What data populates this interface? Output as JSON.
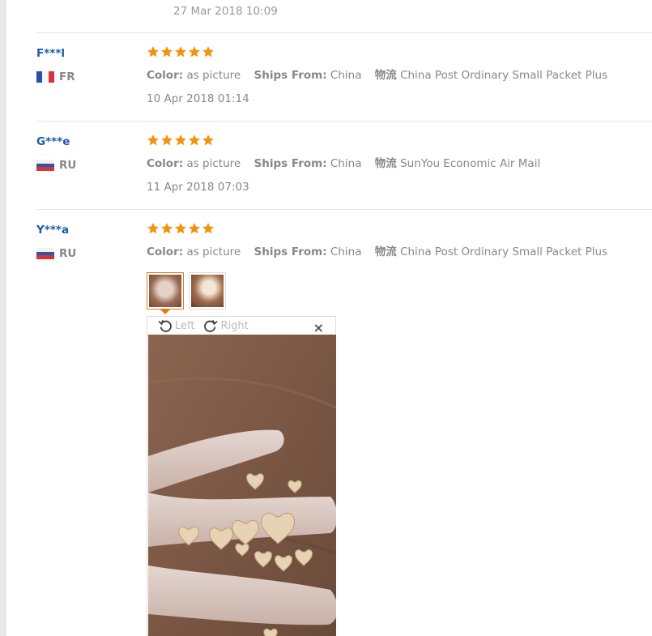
{
  "top_review": {
    "date": "27 Mar 2018 10:09"
  },
  "reviews": [
    {
      "user": "F***l",
      "country": "FR",
      "color_label": "Color:",
      "color_value": "as picture",
      "ships_label": "Ships From:",
      "ships_value": "China",
      "logistics_label": "物流",
      "logistics_value": "China Post Ordinary Small Packet Plus",
      "date": "10 Apr 2018 01:14",
      "rating": 5
    },
    {
      "user": "G***e",
      "country": "RU",
      "color_label": "Color:",
      "color_value": "as picture",
      "ships_label": "Ships From:",
      "ships_value": "China",
      "logistics_label": "物流",
      "logistics_value": "SunYou Economic Air Mail",
      "date": "11 Apr 2018 07:03",
      "rating": 5
    },
    {
      "user": "Y***a",
      "country": "RU",
      "color_label": "Color:",
      "color_value": "as picture",
      "ships_label": "Ships From:",
      "ships_value": "China",
      "logistics_label": "物流",
      "logistics_value": "China Post Ordinary Small Packet Plus",
      "rating": 5
    }
  ],
  "viewer": {
    "rotate_left": "Left",
    "rotate_right": "Right",
    "close": "×"
  },
  "colors": {
    "username": "#1a5ca8",
    "star": "#f2920f",
    "active_thumb": "#e8771b"
  }
}
